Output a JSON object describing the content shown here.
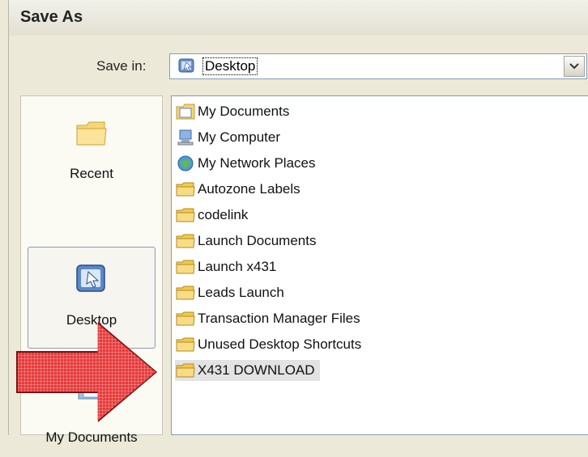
{
  "dialog": {
    "title": "Save As"
  },
  "save_in": {
    "label": "Save in:",
    "value": "Desktop",
    "icon": "desktop-icon"
  },
  "places": [
    {
      "label": "Recent",
      "icon": "recent-folder-icon"
    },
    {
      "label": "Desktop",
      "icon": "desktop-icon"
    },
    {
      "label": "My Documents",
      "icon": "my-documents-icon"
    }
  ],
  "files": [
    {
      "label": "My Documents",
      "icon": "my-documents-icon"
    },
    {
      "label": "My Computer",
      "icon": "my-computer-icon"
    },
    {
      "label": "My Network Places",
      "icon": "network-places-icon"
    },
    {
      "label": "Autozone Labels",
      "icon": "folder-icon"
    },
    {
      "label": "codelink",
      "icon": "folder-icon"
    },
    {
      "label": "Launch Documents",
      "icon": "folder-icon"
    },
    {
      "label": "Launch x431",
      "icon": "folder-icon"
    },
    {
      "label": "Leads Launch",
      "icon": "folder-icon"
    },
    {
      "label": "Transaction Manager Files",
      "icon": "folder-icon"
    },
    {
      "label": "Unused Desktop Shortcuts",
      "icon": "folder-icon"
    },
    {
      "label": "X431 DOWNLOAD",
      "icon": "folder-icon"
    }
  ],
  "colors": {
    "annotation_arrow": "#e63a3a",
    "folder": "#f2c94c"
  }
}
